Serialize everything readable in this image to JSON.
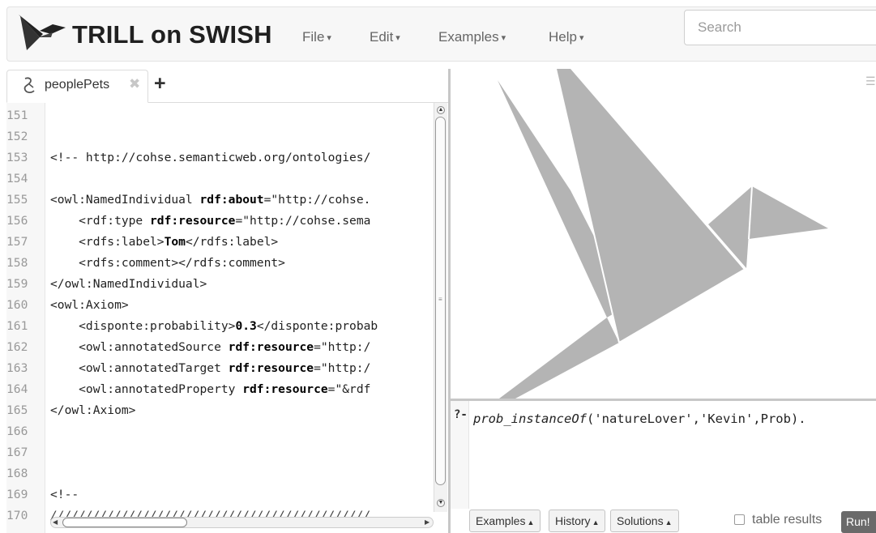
{
  "brand": {
    "title": "TRILL on SWISH"
  },
  "menu": [
    {
      "label": "File"
    },
    {
      "label": "Edit"
    },
    {
      "label": "Examples"
    },
    {
      "label": "Help"
    }
  ],
  "search": {
    "placeholder": "Search"
  },
  "tabs": [
    {
      "label": "peoplePets",
      "close": "✖"
    }
  ],
  "tab_add": "+",
  "editor": {
    "lines": [
      {
        "n": "151",
        "text": ""
      },
      {
        "n": "152",
        "text": ""
      },
      {
        "n": "153",
        "text": "<!-- http://cohse.semanticweb.org/ontologies/"
      },
      {
        "n": "154",
        "text": ""
      },
      {
        "n": "155",
        "pre": "<owl:NamedIndividual ",
        "attr": "rdf:about",
        "post": "=\"http://cohse."
      },
      {
        "n": "156",
        "pre": "    <rdf:type ",
        "attr": "rdf:resource",
        "post": "=\"http://cohse.sema"
      },
      {
        "n": "157",
        "pre": "    <rdfs:label>",
        "attr": "Tom",
        "post": "</rdfs:label>"
      },
      {
        "n": "158",
        "text": "    <rdfs:comment></rdfs:comment>"
      },
      {
        "n": "159",
        "text": "</owl:NamedIndividual>"
      },
      {
        "n": "160",
        "text": "<owl:Axiom>"
      },
      {
        "n": "161",
        "pre": "    <disponte:probability>",
        "attr": "0.3",
        "post": "</disponte:probab"
      },
      {
        "n": "162",
        "pre": "    <owl:annotatedSource ",
        "attr": "rdf:resource",
        "post": "=\"http:/"
      },
      {
        "n": "163",
        "pre": "    <owl:annotatedTarget ",
        "attr": "rdf:resource",
        "post": "=\"http:/"
      },
      {
        "n": "164",
        "pre": "    <owl:annotatedProperty ",
        "attr": "rdf:resource",
        "post": "=\"&rdf"
      },
      {
        "n": "165",
        "text": "</owl:Axiom>"
      },
      {
        "n": "166",
        "text": ""
      },
      {
        "n": "167",
        "text": ""
      },
      {
        "n": "168",
        "text": ""
      },
      {
        "n": "169",
        "text": "<!--"
      },
      {
        "n": "170",
        "text": "/////////////////////////////////////////////"
      }
    ]
  },
  "query": {
    "prompt": "?-",
    "predicate": "prob_instanceOf",
    "args": "('natureLover','Kevin',Prob)."
  },
  "query_buttons": [
    {
      "label": "Examples",
      "caret": "▲"
    },
    {
      "label": "History",
      "caret": "▲"
    },
    {
      "label": "Solutions",
      "caret": "▲"
    }
  ],
  "table_results": {
    "label": "table results",
    "checked": false
  },
  "run_button": {
    "label": "Run!"
  },
  "pane_menu": "☰",
  "colors": {
    "bird": "#b4b4b4",
    "navbar_bg": "#f7f7f7",
    "run_bg": "#6a6a6a"
  }
}
